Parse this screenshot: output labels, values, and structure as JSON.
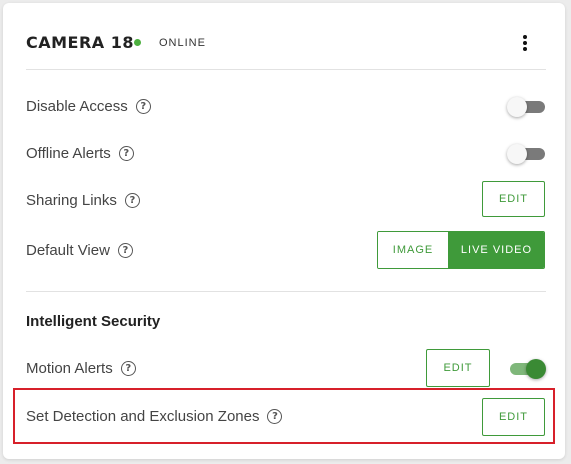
{
  "header": {
    "camera_name": "CAMERA 18",
    "status_text": "ONLINE",
    "status_color": "#4caf3f"
  },
  "settings": {
    "disable_access": {
      "label": "Disable Access",
      "enabled": false
    },
    "offline_alerts": {
      "label": "Offline Alerts",
      "enabled": false
    },
    "sharing_links": {
      "label": "Sharing Links",
      "button_label": "EDIT"
    },
    "default_view": {
      "label": "Default View",
      "options": [
        "IMAGE",
        "LIVE VIDEO"
      ],
      "selected": "LIVE VIDEO"
    }
  },
  "intelligent_security": {
    "title": "Intelligent Security",
    "motion_alerts": {
      "label": "Motion Alerts",
      "button_label": "EDIT",
      "enabled": true
    },
    "zones": {
      "label": "Set Detection and Exclusion Zones",
      "button_label": "EDIT"
    }
  },
  "icons": {
    "help": "?",
    "more": "more-vertical-icon"
  },
  "colors": {
    "accent": "#3f9a3a",
    "highlight": "#d7202a"
  }
}
